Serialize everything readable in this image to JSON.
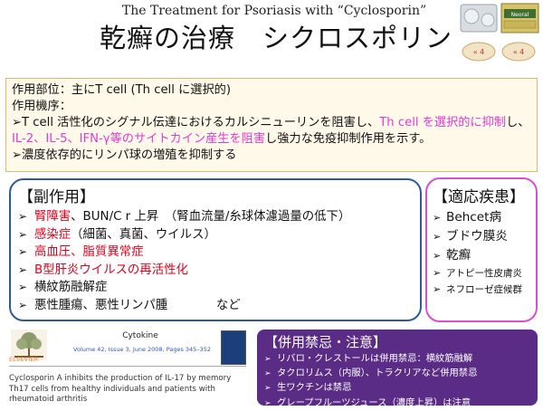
{
  "header": {
    "subtitle": "The Treatment for Psoriasis with “Cyclosporin”",
    "title": "乾癬の治療　シクロスポリン"
  },
  "pills": {
    "pill_label_1": "« 4",
    "pill_label_2": "« 4",
    "package_text": "Neoral"
  },
  "mechanism": {
    "line1": "作用部位：主にT cell (Th cell に選択的)",
    "line2": "作用機序：",
    "line3_a": "➢T cell 活性化のシグナル伝達におけるカルシニューリンを阻害し、",
    "line3_b": "Th cell を選択的に抑制",
    "line3_c": "し、",
    "line3_d": "IL-2、IL-5、IFN-γ等のサイトカイン産生を阻害",
    "line3_e": "し強力な免疫抑制作用を示す。",
    "line4": "➢濃度依存的にリンパ球の増殖を抑制する"
  },
  "side_effects": {
    "heading": "【副作用】",
    "item1_red": "腎障害",
    "item1_rest": "、BUN/C r 上昇　（腎血流量/糸球体濾過量の低下）",
    "item2_red": "感染症",
    "item2_rest": "（細菌、真菌、ウイルス）",
    "item3_red": "高血圧、脂質異常症",
    "item4_red": "B型肝炎ウイルスの再活性化",
    "item5": "横紋筋融解症",
    "item6": "悪性腫瘍、悪性リンパ腫　　　　など"
  },
  "indications": {
    "heading": "【適応疾患】",
    "items": [
      "Behcet病",
      "ブドウ膜炎",
      "乾癬",
      "アトピー性皮膚炎",
      "ネフローゼ症候群"
    ]
  },
  "paper": {
    "publisher": "ELSEVIER",
    "journal": "Cytokine",
    "reference": "Volume 42, Issue 3, June 2008, Pages 345–352",
    "title": "Cyclosporin A inhibits the production of IL-17 by memory Th17 cells from healthy individuals and patients with rheumatoid arthritis"
  },
  "contraindications": {
    "heading": "【併用禁忌・注意】",
    "items": [
      "リバロ・クレストールは併用禁忌：横紋筋融解",
      "タクロリムス（内服）、トラクリアなど併用禁忌",
      "生ワクチンは禁忌",
      "グレープフルーツジュース（濃度上昇）は注意"
    ]
  }
}
